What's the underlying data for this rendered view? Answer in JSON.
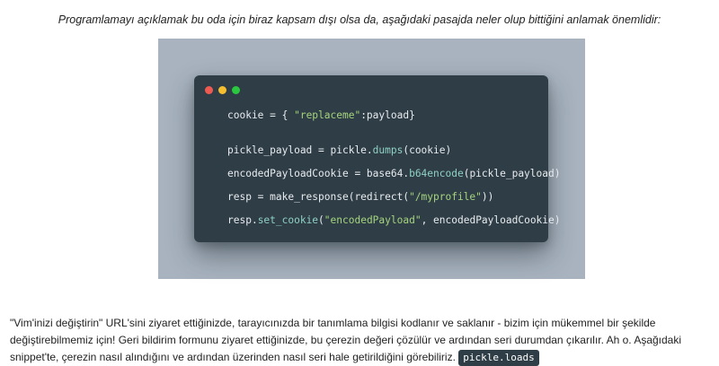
{
  "caption": "Programlamayı açıklamak bu oda için biraz kapsam dışı olsa da, aşağıdaki pasajda neler olup bittiğini anlamak önemlidir:",
  "colors": {
    "figure_bg": "#a8b3bf",
    "window_bg": "#2f3d46",
    "dot_red": "#ee5a52",
    "dot_yellow": "#f5be2e",
    "dot_green": "#2ac83f",
    "string": "#a5d47e",
    "function": "#8fd1c4",
    "plain": "#e8ecef"
  },
  "window_controls": [
    "close-dot",
    "minimize-dot",
    "maximize-dot"
  ],
  "code": {
    "line1": {
      "a": "cookie = { ",
      "s1": "\"replaceme\"",
      "b": ":payload}"
    },
    "line2": {
      "a": "pickle_payload = pickle.",
      "f1": "dumps",
      "b": "(cookie)"
    },
    "line3": {
      "a": "encodedPayloadCookie = base64.",
      "f1": "b64encode",
      "b": "(pickle_payload)"
    },
    "line4": {
      "a": "resp = make_response(redirect(",
      "s1": "\"/myprofile\"",
      "b": "))"
    },
    "line5": {
      "a": "resp.",
      "f1": "set_cookie",
      "b": "(",
      "s1": "\"encodedPayload\"",
      "c": ", encodedPayloadCookie)"
    }
  },
  "paragraph": {
    "text": "\"Vim'inizi değiştirin\" URL'sini ziyaret ettiğinizde, tarayıcınızda bir tanımlama bilgisi kodlanır ve saklanır - bizim için mükemmel bir şekilde değiştirebilmemiz için! Geri bildirim formunu ziyaret ettiğinizde, bu çerezin değeri çözülür ve ardından seri durumdan çıkarılır. Ah o. Aşağıdaki snippet'te, çerezin nasıl alındığını ve ardından üzerinden nasıl seri hale getirildiğini görebiliriz. ",
    "inline_code": "pickle.loads"
  }
}
